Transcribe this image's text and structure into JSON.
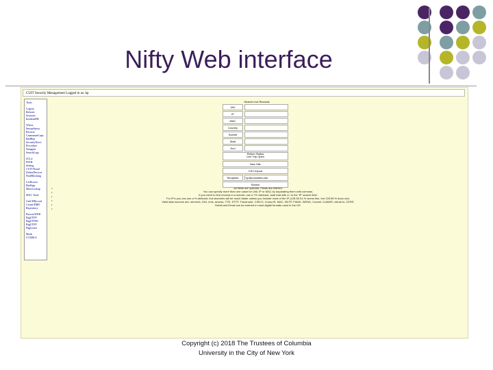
{
  "slide": {
    "title": "Nifty Web interface",
    "footer_line1": "Copyright (c) 2018 The Trustees of Columbia",
    "footer_line2": "University in the City of New York"
  },
  "colors": {
    "title": "#3b1d5a",
    "dot_purple": "#4b2563",
    "dot_teal": "#7f9ea3",
    "dot_olive": "#b5b52a",
    "dot_lavender": "#c8c6d6",
    "frame_bg": "#fbfbd8"
  },
  "browser": {
    "header": "CUIT Security Management   Logged in as: hp",
    "sidebar_groups": [
      [
        "Tools"
      ],
      [
        "Logout",
        "Refresh",
        "Sessions",
        "IncidentDB"
      ],
      [
        "Whois",
        "SnoopStatus",
        "Reverse",
        "CatamaranCups",
        "BadRep",
        "SecurityNews",
        "Procedure",
        "Netagent",
        "SearchLogs"
      ],
      [
        "ZCL4",
        "PSTB",
        "Setting",
        "CUIT/Portal",
        "DeleteDevices",
        "FindBlocking"
      ],
      [
        "LesBrown",
        "BadSigs",
        "MassLookup"
      ],
      [
        "MAC Tools"
      ],
      [
        "UniCDRecord",
        "Create/DBD",
        "Repository"
      ],
      [
        "BrowseWEB",
        "BigUTFP",
        "BigUTFP6",
        "BigUTFP",
        "BigListen"
      ],
      [
        "Mods",
        "CCMSLS"
      ]
    ],
    "form": {
      "title": "Search Live Records",
      "fields": [
        {
          "label": "UNI",
          "value": ""
        },
        {
          "label": "IP",
          "value": ""
        },
        {
          "label": "MAC",
          "value": ""
        },
        {
          "label": "Country",
          "value": ""
        },
        {
          "label": "Subnet",
          "value": ""
        },
        {
          "label": "Start",
          "value": ""
        },
        {
          "label": "End",
          "value": ""
        }
      ],
      "radio_title": "Return Status",
      "radio_options": "Live  Trip  Open",
      "max_hits_label": "Max Hits",
      "csv_label": "CSV export",
      "recipient_label": "Recipient",
      "recipient_value": "hp@columbia.edu",
      "search_label": "Search"
    },
    "notes": [
      "All fields are optional. Fields are ANDed.",
      "You can specify more than one value for UNI, IP or MAC by separating them with commas.",
      "If you need to find records in a subnet, use a '/%' wildcard, start that with a / in the 'IP' search field.",
      "For IP's you can use a % wildcard, but searches will be much faster unless you include most of the IP (128.59.31.% works fine, but 128.59.% does not).",
      "Valid data sources are: services, DNI, nms, access, TTR, STTP, Traceroute, CISCO, Cross-IR, MAC, SNTP, FWAS, WEND, Coxrail, CUAWR, virtual to, CERS.",
      "Detail and Email can be entered in most digital formats used in the US."
    ]
  }
}
